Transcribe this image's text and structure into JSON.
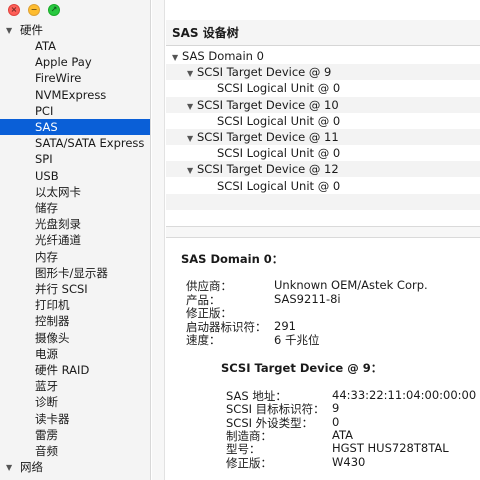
{
  "window": {
    "close_glyph": "×",
    "min_glyph": "−",
    "max_glyph": "↗"
  },
  "sidebar": {
    "hardware_group": "硬件",
    "hardware_items": [
      "ATA",
      "Apple Pay",
      "FireWire",
      "NVMExpress",
      "PCI",
      "SAS",
      "SATA/SATA Express",
      "SPI",
      "USB",
      "以太网卡",
      "储存",
      "光盘刻录",
      "光纤通道",
      "内存",
      "图形卡/显示器",
      "并行 SCSI",
      "打印机",
      "控制器",
      "摄像头",
      "电源",
      "硬件 RAID",
      "蓝牙",
      "诊断",
      "读卡器",
      "雷雳",
      "音频"
    ],
    "selected_item": "SAS",
    "network_group": "网络",
    "colors": {
      "selected_bg": "#0a5fd7",
      "selected_text": "#ffffff"
    }
  },
  "tree": {
    "header": "SAS 设备树",
    "rows": [
      {
        "label": "SAS Domain 0",
        "level": 0,
        "expanded": true
      },
      {
        "label": "SCSI Target Device @ 9",
        "level": 1,
        "expanded": true
      },
      {
        "label": "SCSI Logical Unit @ 0",
        "level": 2
      },
      {
        "label": "SCSI Target Device @ 10",
        "level": 1,
        "expanded": true
      },
      {
        "label": "SCSI Logical Unit @ 0",
        "level": 2
      },
      {
        "label": "SCSI Target Device @ 11",
        "level": 1,
        "expanded": true
      },
      {
        "label": "SCSI Logical Unit @ 0",
        "level": 2
      },
      {
        "label": "SCSI Target Device @ 12",
        "level": 1,
        "expanded": true
      },
      {
        "label": "SCSI Logical Unit @ 0",
        "level": 2
      }
    ]
  },
  "detail": {
    "domain_title": "SAS Domain 0：",
    "domain_fields": [
      {
        "label": "供应商：",
        "value": "Unknown OEM/Astek Corp."
      },
      {
        "label": "产品：",
        "value": "SAS9211-8i"
      },
      {
        "label": "修正版：",
        "value": ""
      },
      {
        "label": "启动器标识符：",
        "value": "291"
      },
      {
        "label": "速度：",
        "value": "6 千兆位"
      }
    ],
    "target_title": "SCSI Target Device @ 9：",
    "target_fields": [
      {
        "label": "SAS 地址：",
        "value": "44:33:22:11:04:00:00:00"
      },
      {
        "label": "SCSI 目标标识符：",
        "value": "9"
      },
      {
        "label": "SCSI 外设类型：",
        "value": "0"
      },
      {
        "label": "制造商：",
        "value": "ATA"
      },
      {
        "label": "型号：",
        "value": "HGST HUS728T8TAL"
      },
      {
        "label": "修正版：",
        "value": "W430"
      }
    ]
  }
}
